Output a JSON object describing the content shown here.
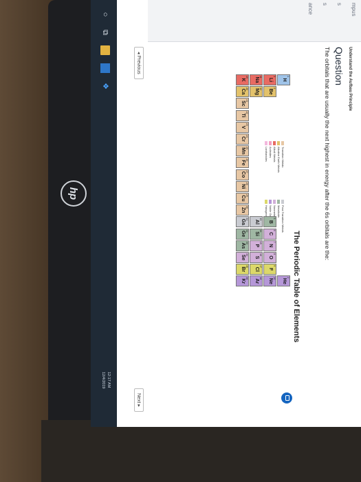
{
  "side_texts": [
    "mpus",
    "s",
    "s",
    "ance"
  ],
  "breadcrumb": "Understand the Aufbau Principle",
  "question_title": "Question",
  "question_text": "The orbitals that are usually the next highest in energy after the 6s orbitals are the:",
  "periodic_table_title": "The Periodic Table of Elements",
  "legend": {
    "col1": [
      {
        "label": "Transition Metals",
        "color": "#e7c7a4"
      },
      {
        "label": "Alkaline Earth Metals",
        "color": "#e3c26b"
      },
      {
        "label": "Alkali Metals",
        "color": "#e86b63"
      },
      {
        "label": "Actinides",
        "color": "#f2a1c1"
      },
      {
        "label": "Lanthanides",
        "color": "#f3b8dd"
      }
    ],
    "col2": [
      {
        "label": "Post-Transition Metals",
        "color": "#c9cbd1"
      },
      {
        "label": "Metalloids",
        "color": "#9fb7a3"
      },
      {
        "label": "Nonmetals",
        "color": "#d2b0d9"
      },
      {
        "label": "Noble Gases",
        "color": "#b597d8"
      },
      {
        "label": "Halogens",
        "color": "#dcd86a"
      }
    ]
  },
  "elements": [
    {
      "sym": "H",
      "num": "1",
      "color": "#9fc3e8"
    },
    {
      "sym": "He",
      "num": "2",
      "color": "#b597d8"
    },
    {
      "sym": "Li",
      "num": "3",
      "color": "#e86b63"
    },
    {
      "sym": "Be",
      "num": "4",
      "color": "#e3c26b"
    },
    {
      "sym": "B",
      "num": "5",
      "color": "#9fb7a3"
    },
    {
      "sym": "C",
      "num": "6",
      "color": "#d2b0d9"
    },
    {
      "sym": "N",
      "num": "7",
      "color": "#d2b0d9"
    },
    {
      "sym": "O",
      "num": "8",
      "color": "#d2b0d9"
    },
    {
      "sym": "F",
      "num": "9",
      "color": "#dcd86a"
    },
    {
      "sym": "Ne",
      "num": "10",
      "color": "#b597d8"
    },
    {
      "sym": "Na",
      "num": "11",
      "color": "#e86b63"
    },
    {
      "sym": "Mg",
      "num": "12",
      "color": "#e3c26b"
    },
    {
      "sym": "Al",
      "num": "13",
      "color": "#c9cbd1"
    },
    {
      "sym": "Si",
      "num": "14",
      "color": "#9fb7a3"
    },
    {
      "sym": "P",
      "num": "15",
      "color": "#d2b0d9"
    },
    {
      "sym": "S",
      "num": "16",
      "color": "#d2b0d9"
    },
    {
      "sym": "Cl",
      "num": "17",
      "color": "#dcd86a"
    },
    {
      "sym": "Ar",
      "num": "18",
      "color": "#b597d8"
    },
    {
      "sym": "K",
      "num": "19",
      "color": "#e86b63"
    },
    {
      "sym": "Ca",
      "num": "20",
      "color": "#e3c26b"
    },
    {
      "sym": "Sc",
      "num": "21",
      "color": "#e7c7a4"
    },
    {
      "sym": "Ti",
      "num": "22",
      "color": "#e7c7a4"
    },
    {
      "sym": "V",
      "num": "23",
      "color": "#e7c7a4"
    },
    {
      "sym": "Cr",
      "num": "24",
      "color": "#e7c7a4"
    },
    {
      "sym": "Mn",
      "num": "25",
      "color": "#e7c7a4"
    },
    {
      "sym": "Fe",
      "num": "26",
      "color": "#e7c7a4"
    },
    {
      "sym": "Co",
      "num": "27",
      "color": "#e7c7a4"
    },
    {
      "sym": "Ni",
      "num": "28",
      "color": "#e7c7a4"
    },
    {
      "sym": "Cu",
      "num": "29",
      "color": "#e7c7a4"
    },
    {
      "sym": "Zn",
      "num": "30",
      "color": "#e7c7a4"
    },
    {
      "sym": "Ga",
      "num": "31",
      "color": "#c9cbd1"
    },
    {
      "sym": "Ge",
      "num": "32",
      "color": "#9fb7a3"
    },
    {
      "sym": "As",
      "num": "33",
      "color": "#9fb7a3"
    },
    {
      "sym": "Se",
      "num": "34",
      "color": "#d2b0d9"
    },
    {
      "sym": "Br",
      "num": "35",
      "color": "#dcd86a"
    },
    {
      "sym": "Kr",
      "num": "36",
      "color": "#b597d8"
    }
  ],
  "prev_label": "◂ Previous",
  "next_label": "Next ▸",
  "taskbar": {
    "time": "12:17 AM",
    "date": "12/4/2019"
  }
}
